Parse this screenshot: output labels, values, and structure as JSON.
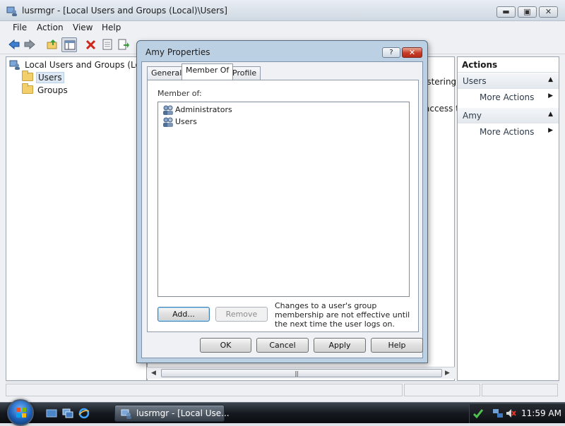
{
  "window": {
    "title": "lusrmgr - [Local Users and Groups (Local)\\Users]"
  },
  "menu": {
    "items": [
      "File",
      "Action",
      "View",
      "Help"
    ]
  },
  "tree": {
    "root": "Local Users and Groups (Local",
    "children": [
      "Users",
      "Groups"
    ]
  },
  "middle": {
    "peek_lines": [
      "istering",
      "access t"
    ]
  },
  "actions": {
    "header": "Actions",
    "sections": [
      {
        "title": "Users",
        "items": [
          "More Actions"
        ]
      },
      {
        "title": "Amy",
        "items": [
          "More Actions"
        ]
      }
    ]
  },
  "dialog": {
    "title": "Amy Properties",
    "help_glyph": "?",
    "tabs": [
      "General",
      "Member Of",
      "Profile"
    ],
    "active_tab": "Member Of",
    "member_of_label": "Member of:",
    "groups": [
      "Administrators",
      "Users"
    ],
    "add_button": "Add...",
    "remove_button": "Remove",
    "note": "Changes to a user's group membership are not effective until the next time the user logs on.",
    "ok": "OK",
    "cancel": "Cancel",
    "apply": "Apply",
    "help": "Help"
  },
  "taskbar": {
    "task_label": "lusrmgr - [Local Use...",
    "clock": "11:59 AM"
  },
  "icons": {
    "back": "back-arrow-icon",
    "forward": "forward-arrow-icon",
    "up": "up-folder-icon",
    "show_tree": "show-hide-console-tree-icon",
    "delete": "delete-x-icon",
    "properties": "properties-icon",
    "export": "export-list-icon"
  },
  "colors": {
    "title_gradient_top": "#e9eef4",
    "dialog_frame": "#bcd0e3",
    "close_red": "#c43b26",
    "taskbar": "#161a20"
  }
}
